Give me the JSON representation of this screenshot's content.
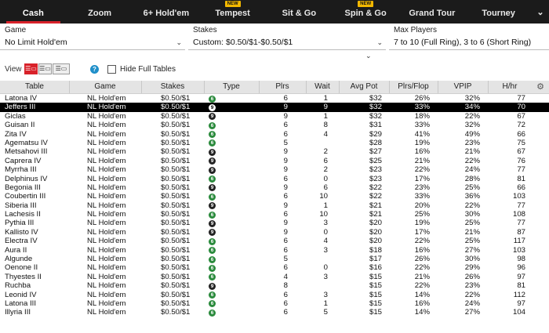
{
  "nav": {
    "tabs": [
      {
        "label": "Cash",
        "active": true,
        "badge": ""
      },
      {
        "label": "Zoom",
        "active": false,
        "badge": ""
      },
      {
        "label": "6+ Hold'em",
        "active": false,
        "badge": ""
      },
      {
        "label": "Tempest",
        "active": false,
        "badge": "NEW"
      },
      {
        "label": "Sit & Go",
        "active": false,
        "badge": ""
      },
      {
        "label": "Spin & Go",
        "active": false,
        "badge": "NEW"
      },
      {
        "label": "Grand Tour",
        "active": false,
        "badge": ""
      },
      {
        "label": "Tourney",
        "active": false,
        "badge": ""
      }
    ]
  },
  "filters": {
    "game": {
      "label": "Game",
      "value": "No Limit Hold'em"
    },
    "stakes": {
      "label": "Stakes",
      "value": "Custom: $0.50/$1-$0.50/$1"
    },
    "max_players": {
      "label": "Max Players",
      "value": "7 to 10 (Full Ring), 3 to 6 (Short Ring)"
    }
  },
  "view": {
    "label": "View",
    "hide_full_label": "Hide Full Tables",
    "hide_full_checked": false
  },
  "table": {
    "headers": {
      "table": "Table",
      "game": "Game",
      "stakes": "Stakes",
      "type": "Type",
      "plrs": "Plrs",
      "wait": "Wait",
      "avg_pot": "Avg Pot",
      "plrs_flop": "Plrs/Flop",
      "vpip": "VPIP",
      "hhr": "H/hr"
    },
    "rows": [
      {
        "table": "Latona IV",
        "game": "NL Hold'em",
        "stakes": "$0.50/$1",
        "type": "6",
        "plrs": "6",
        "wait": "1",
        "avg_pot": "$32",
        "plrs_flop": "26%",
        "vpip": "32%",
        "hhr": "77",
        "selected": false
      },
      {
        "table": "Jeffers III",
        "game": "NL Hold'em",
        "stakes": "$0.50/$1",
        "type": "9",
        "plrs": "9",
        "wait": "9",
        "avg_pot": "$32",
        "plrs_flop": "33%",
        "vpip": "34%",
        "hhr": "70",
        "selected": true
      },
      {
        "table": "Giclas",
        "game": "NL Hold'em",
        "stakes": "$0.50/$1",
        "type": "9",
        "plrs": "9",
        "wait": "1",
        "avg_pot": "$32",
        "plrs_flop": "18%",
        "vpip": "22%",
        "hhr": "67",
        "selected": false
      },
      {
        "table": "Guisan II",
        "game": "NL Hold'em",
        "stakes": "$0.50/$1",
        "type": "6",
        "plrs": "6",
        "wait": "8",
        "avg_pot": "$31",
        "plrs_flop": "33%",
        "vpip": "32%",
        "hhr": "72",
        "selected": false
      },
      {
        "table": "Zita IV",
        "game": "NL Hold'em",
        "stakes": "$0.50/$1",
        "type": "6",
        "plrs": "6",
        "wait": "4",
        "avg_pot": "$29",
        "plrs_flop": "41%",
        "vpip": "49%",
        "hhr": "66",
        "selected": false
      },
      {
        "table": "Agematsu IV",
        "game": "NL Hold'em",
        "stakes": "$0.50/$1",
        "type": "6",
        "plrs": "5",
        "wait": "",
        "avg_pot": "$28",
        "plrs_flop": "19%",
        "vpip": "23%",
        "hhr": "75",
        "selected": false
      },
      {
        "table": "Metsahovi III",
        "game": "NL Hold'em",
        "stakes": "$0.50/$1",
        "type": "9",
        "plrs": "9",
        "wait": "2",
        "avg_pot": "$27",
        "plrs_flop": "16%",
        "vpip": "21%",
        "hhr": "67",
        "selected": false
      },
      {
        "table": "Caprera IV",
        "game": "NL Hold'em",
        "stakes": "$0.50/$1",
        "type": "9",
        "plrs": "9",
        "wait": "6",
        "avg_pot": "$25",
        "plrs_flop": "21%",
        "vpip": "22%",
        "hhr": "76",
        "selected": false
      },
      {
        "table": "Myrrha III",
        "game": "NL Hold'em",
        "stakes": "$0.50/$1",
        "type": "9",
        "plrs": "9",
        "wait": "2",
        "avg_pot": "$23",
        "plrs_flop": "22%",
        "vpip": "24%",
        "hhr": "77",
        "selected": false
      },
      {
        "table": "Delphinus IV",
        "game": "NL Hold'em",
        "stakes": "$0.50/$1",
        "type": "6",
        "plrs": "6",
        "wait": "0",
        "avg_pot": "$23",
        "plrs_flop": "17%",
        "vpip": "28%",
        "hhr": "81",
        "selected": false
      },
      {
        "table": "Begonia III",
        "game": "NL Hold'em",
        "stakes": "$0.50/$1",
        "type": "9",
        "plrs": "9",
        "wait": "6",
        "avg_pot": "$22",
        "plrs_flop": "23%",
        "vpip": "25%",
        "hhr": "66",
        "selected": false
      },
      {
        "table": "Coubertin III",
        "game": "NL Hold'em",
        "stakes": "$0.50/$1",
        "type": "6",
        "plrs": "6",
        "wait": "10",
        "avg_pot": "$22",
        "plrs_flop": "33%",
        "vpip": "36%",
        "hhr": "103",
        "selected": false
      },
      {
        "table": "Siberia III",
        "game": "NL Hold'em",
        "stakes": "$0.50/$1",
        "type": "9",
        "plrs": "9",
        "wait": "1",
        "avg_pot": "$21",
        "plrs_flop": "20%",
        "vpip": "22%",
        "hhr": "77",
        "selected": false
      },
      {
        "table": "Lachesis II",
        "game": "NL Hold'em",
        "stakes": "$0.50/$1",
        "type": "6",
        "plrs": "6",
        "wait": "10",
        "avg_pot": "$21",
        "plrs_flop": "25%",
        "vpip": "30%",
        "hhr": "108",
        "selected": false
      },
      {
        "table": "Pythia III",
        "game": "NL Hold'em",
        "stakes": "$0.50/$1",
        "type": "9",
        "plrs": "9",
        "wait": "3",
        "avg_pot": "$20",
        "plrs_flop": "19%",
        "vpip": "25%",
        "hhr": "77",
        "selected": false
      },
      {
        "table": "Kallisto IV",
        "game": "NL Hold'em",
        "stakes": "$0.50/$1",
        "type": "9",
        "plrs": "9",
        "wait": "0",
        "avg_pot": "$20",
        "plrs_flop": "17%",
        "vpip": "21%",
        "hhr": "87",
        "selected": false
      },
      {
        "table": "Electra IV",
        "game": "NL Hold'em",
        "stakes": "$0.50/$1",
        "type": "6",
        "plrs": "6",
        "wait": "4",
        "avg_pot": "$20",
        "plrs_flop": "22%",
        "vpip": "25%",
        "hhr": "117",
        "selected": false
      },
      {
        "table": "Aura II",
        "game": "NL Hold'em",
        "stakes": "$0.50/$1",
        "type": "6",
        "plrs": "6",
        "wait": "3",
        "avg_pot": "$18",
        "plrs_flop": "16%",
        "vpip": "27%",
        "hhr": "103",
        "selected": false
      },
      {
        "table": "Algunde",
        "game": "NL Hold'em",
        "stakes": "$0.50/$1",
        "type": "6",
        "plrs": "5",
        "wait": "",
        "avg_pot": "$17",
        "plrs_flop": "26%",
        "vpip": "30%",
        "hhr": "98",
        "selected": false
      },
      {
        "table": "Oenone II",
        "game": "NL Hold'em",
        "stakes": "$0.50/$1",
        "type": "6",
        "plrs": "6",
        "wait": "0",
        "avg_pot": "$16",
        "plrs_flop": "22%",
        "vpip": "29%",
        "hhr": "96",
        "selected": false
      },
      {
        "table": "Thyestes II",
        "game": "NL Hold'em",
        "stakes": "$0.50/$1",
        "type": "6",
        "plrs": "4",
        "wait": "3",
        "avg_pot": "$15",
        "plrs_flop": "21%",
        "vpip": "26%",
        "hhr": "97",
        "selected": false
      },
      {
        "table": "Ruchba",
        "game": "NL Hold'em",
        "stakes": "$0.50/$1",
        "type": "9",
        "plrs": "8",
        "wait": "",
        "avg_pot": "$15",
        "plrs_flop": "22%",
        "vpip": "23%",
        "hhr": "81",
        "selected": false
      },
      {
        "table": "Leonid IV",
        "game": "NL Hold'em",
        "stakes": "$0.50/$1",
        "type": "6",
        "plrs": "6",
        "wait": "3",
        "avg_pot": "$15",
        "plrs_flop": "14%",
        "vpip": "22%",
        "hhr": "112",
        "selected": false
      },
      {
        "table": "Latona III",
        "game": "NL Hold'em",
        "stakes": "$0.50/$1",
        "type": "6",
        "plrs": "6",
        "wait": "1",
        "avg_pot": "$15",
        "plrs_flop": "16%",
        "vpip": "24%",
        "hhr": "97",
        "selected": false
      },
      {
        "table": "Illyria III",
        "game": "NL Hold'em",
        "stakes": "$0.50/$1",
        "type": "6",
        "plrs": "6",
        "wait": "5",
        "avg_pot": "$15",
        "plrs_flop": "14%",
        "vpip": "27%",
        "hhr": "104",
        "selected": false
      }
    ]
  },
  "colors": {
    "accent": "#d8222a",
    "nav_bg": "#1b1b1b",
    "type6": "#2a8a3c",
    "type9": "#222222",
    "selected_row": "#000000",
    "new_badge": "#f3b800"
  },
  "icons": {
    "view_modes": [
      "list-icon",
      "compact-list-icon",
      "detail-list-icon"
    ],
    "help": "question-circle-icon",
    "settings": "gear-icon",
    "collapse": "chevron-down-icon",
    "dropdown": "chevron-down-icon"
  }
}
